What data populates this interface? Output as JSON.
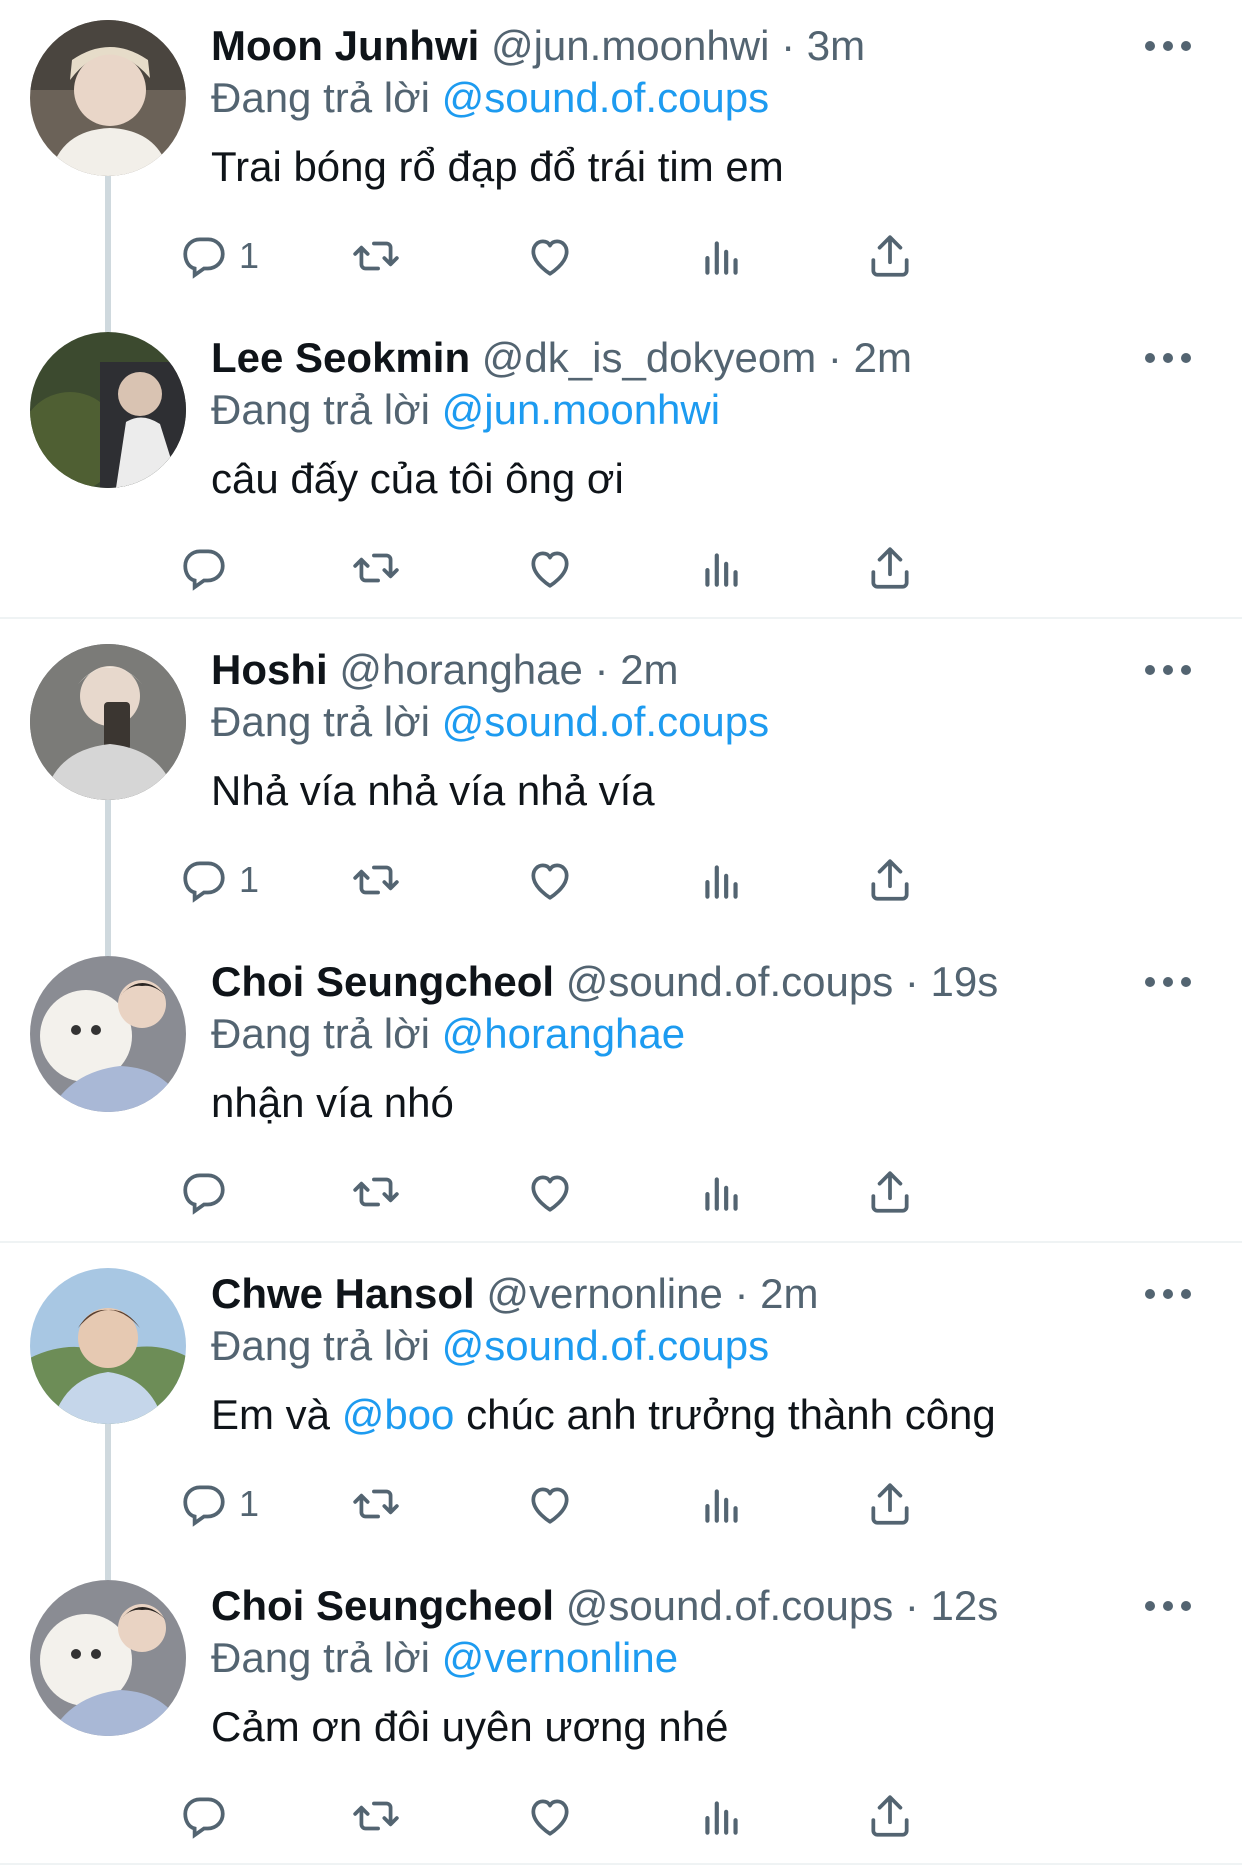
{
  "colors": {
    "link": "#1d9bf0",
    "secondary": "#536471",
    "text": "#0f1419",
    "divider": "#eff3f4",
    "thread": "#cfd9de"
  },
  "tweets": [
    {
      "name": "Moon Junhwi",
      "handle": "@jun.moonhwi",
      "time": "3m",
      "reply_prefix": "Đang trả lời",
      "reply_to": "@sound.of.coups",
      "text_before": "Trai bóng rổ đạp đổ trái tim em",
      "mention": "",
      "text_after": "",
      "reply_count": "1"
    },
    {
      "name": "Lee Seokmin",
      "handle": "@dk_is_dokyeom",
      "time": "2m",
      "reply_prefix": "Đang trả lời",
      "reply_to": "@jun.moonhwi",
      "text_before": "câu đấy của tôi ông ơi",
      "mention": "",
      "text_after": "",
      "reply_count": ""
    },
    {
      "name": "Hoshi",
      "handle": "@horanghae",
      "time": "2m",
      "reply_prefix": "Đang trả lời",
      "reply_to": "@sound.of.coups",
      "text_before": "Nhả vía nhả vía nhả vía",
      "mention": "",
      "text_after": "",
      "reply_count": "1"
    },
    {
      "name": "Choi Seungcheol",
      "handle": "@sound.of.coups",
      "time": "19s",
      "reply_prefix": "Đang trả lời",
      "reply_to": "@horanghae",
      "text_before": "nhận vía nhó",
      "mention": "",
      "text_after": "",
      "reply_count": ""
    },
    {
      "name": "Chwe Hansol",
      "handle": "@vernonline",
      "time": "2m",
      "reply_prefix": "Đang trả lời",
      "reply_to": "@sound.of.coups",
      "text_before": "Em và ",
      "mention": "@boo",
      "text_after": " chúc anh trưởng thành công",
      "reply_count": "1"
    },
    {
      "name": "Choi Seungcheol",
      "handle": "@sound.of.coups",
      "time": "12s",
      "reply_prefix": "Đang trả lời",
      "reply_to": "@vernonline",
      "text_before": "Cảm ơn đôi uyên ương nhé",
      "mention": "",
      "text_after": "",
      "reply_count": ""
    }
  ],
  "icons": {
    "more": "more-horizontal-icon",
    "reply": "reply-icon",
    "retweet": "retweet-icon",
    "like": "heart-icon",
    "views": "views-chart-icon",
    "share": "share-icon"
  }
}
